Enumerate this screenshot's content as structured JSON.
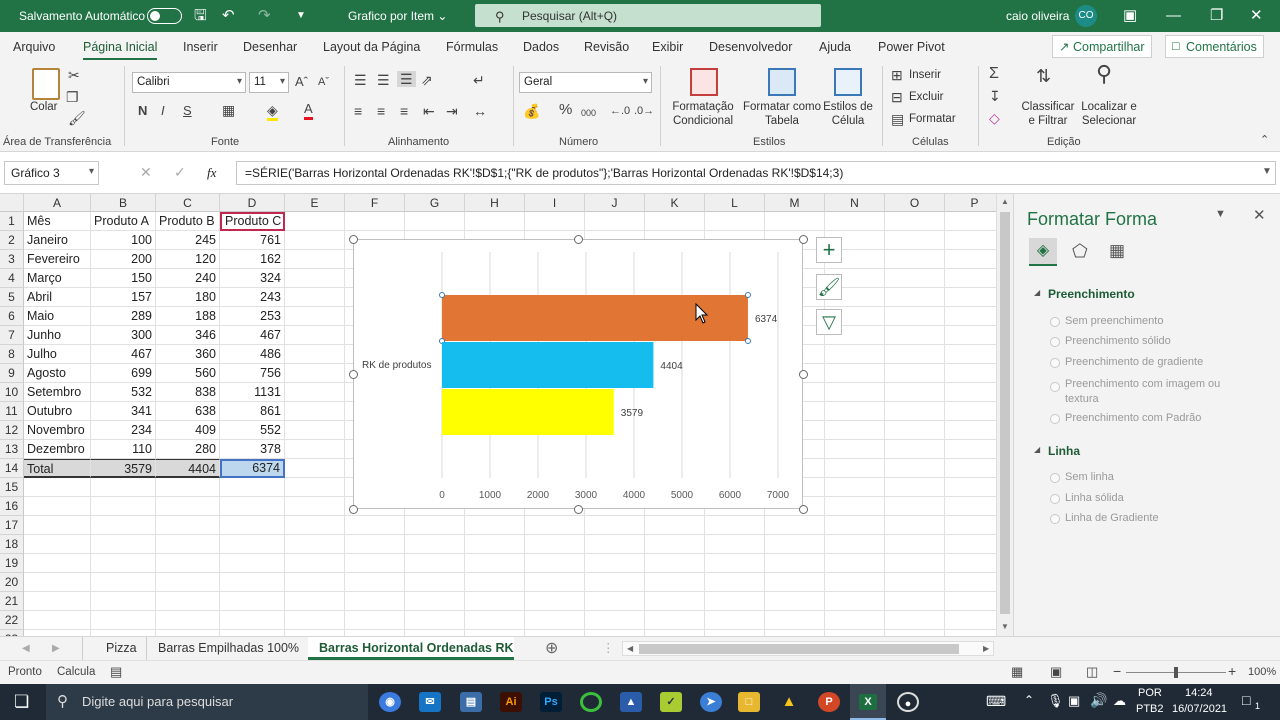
{
  "titlebar": {
    "autosave_label": "Salvamento Automático",
    "doc_title": "Grafico por Item",
    "doc_title_caret": "⌄",
    "search_placeholder": "Pesquisar (Alt+Q)",
    "user_name": "caio oliveira",
    "user_initials": "CO"
  },
  "menu": {
    "tabs": [
      "Arquivo",
      "Página Inicial",
      "Inserir",
      "Desenhar",
      "Layout da Página",
      "Fórmulas",
      "Dados",
      "Revisão",
      "Exibir",
      "Desenvolvedor",
      "Ajuda",
      "Power Pivot"
    ],
    "share_label": "Compartilhar",
    "comments_label": "Comentários"
  },
  "ribbon": {
    "paste_label": "Colar",
    "clipboard_group": "Área de Transferência",
    "font_name": "Calibri",
    "font_size": "11",
    "bold": "N",
    "italic": "I",
    "underline": "S",
    "font_group": "Fonte",
    "align_group": "Alinhamento",
    "number_format": "Geral",
    "number_group": "Número",
    "percent": "%",
    "thousands": "000",
    "cond_format": "Formatação Condicional",
    "format_table": "Formatar como Tabela",
    "cell_styles": "Estilos de Célula",
    "styles_group": "Estilos",
    "insert_label": "Inserir",
    "delete_label": "Excluir",
    "format_label": "Formatar",
    "cells_group": "Células",
    "sort_filter": "Classificar e Filtrar",
    "find_select": "Localizar e Selecionar",
    "edit_group": "Edição"
  },
  "formula_bar": {
    "name_box": "Gráfico 3",
    "fx": "fx",
    "formula": "=SÉRIE('Barras Horizontal Ordenadas RK'!$D$1;{\"RK de produtos\"};'Barras Horizontal Ordenadas RK'!$D$14;3)"
  },
  "sheet": {
    "columns": [
      "A",
      "B",
      "C",
      "D",
      "E",
      "F",
      "G",
      "H",
      "I",
      "J",
      "K",
      "L",
      "M",
      "N",
      "O",
      "P"
    ],
    "rows": [
      [
        "Mês",
        "Produto A",
        "Produto B",
        "Produto C"
      ],
      [
        "Janeiro",
        "100",
        "245",
        "761"
      ],
      [
        "Fevereiro",
        "200",
        "120",
        "162"
      ],
      [
        "Março",
        "150",
        "240",
        "324"
      ],
      [
        "Abril",
        "157",
        "180",
        "243"
      ],
      [
        "Maio",
        "289",
        "188",
        "253"
      ],
      [
        "Junho",
        "300",
        "346",
        "467"
      ],
      [
        "Julho",
        "467",
        "360",
        "486"
      ],
      [
        "Agosto",
        "699",
        "560",
        "756"
      ],
      [
        "Setembro",
        "532",
        "838",
        "1131"
      ],
      [
        "Outubro",
        "341",
        "638",
        "861"
      ],
      [
        "Novembro",
        "234",
        "409",
        "552"
      ],
      [
        "Dezembro",
        "110",
        "280",
        "378"
      ],
      [
        "Total",
        "3579",
        "4404",
        "6374"
      ],
      [
        "",
        "",
        "",
        ""
      ],
      [
        "",
        "",
        "",
        ""
      ],
      [
        "",
        "",
        "",
        ""
      ],
      [
        "",
        "",
        "",
        ""
      ],
      [
        "",
        "",
        "",
        ""
      ],
      [
        "",
        "",
        "",
        ""
      ],
      [
        "",
        "",
        "",
        ""
      ],
      [
        "",
        "",
        "",
        ""
      ],
      [
        "",
        "",
        "",
        ""
      ]
    ]
  },
  "chart_data": {
    "type": "bar",
    "orientation": "horizontal",
    "category": "RK de produtos",
    "bars": [
      {
        "value": 6374,
        "color": "#e07534"
      },
      {
        "value": 4404,
        "color": "#14bdee"
      },
      {
        "value": 3579,
        "color": "#ffff00"
      }
    ],
    "xlim": [
      0,
      7000
    ],
    "xticks": [
      "0",
      "1000",
      "2000",
      "3000",
      "4000",
      "5000",
      "6000",
      "7000"
    ],
    "grid": "vertical",
    "title": ""
  },
  "panel": {
    "title": "Formatar Forma",
    "fill_section": "Preenchimento",
    "fill_options": [
      "Sem preenchimento",
      "Preenchimento sólido",
      "Preenchimento de gradiente",
      "Preenchimento com imagem ou textura",
      "Preenchimento com Padrão"
    ],
    "line_section": "Linha",
    "line_options": [
      "Sem linha",
      "Linha sólida",
      "Linha de Gradiente"
    ]
  },
  "sheet_tabs": {
    "tabs": [
      "Pizza",
      "Barras Empilhadas 100%",
      "Barras Horizontal Ordenadas RK"
    ],
    "active": 2
  },
  "status": {
    "ready": "Pronto",
    "calc": "Calcula",
    "zoom": "100%"
  },
  "taskbar": {
    "search_placeholder": "Digite aqui para pesquisar",
    "lang": "POR",
    "layout": "PTB2",
    "time": "14:24",
    "date": "16/07/2021",
    "notifications": "1"
  }
}
